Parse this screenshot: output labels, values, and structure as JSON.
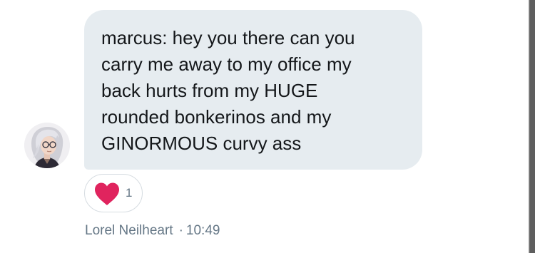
{
  "message": {
    "lines": [
      "marcus: hey you there can you",
      "carry me away to my office my",
      "back hurts from my HUGE",
      "rounded bonkerinos and my",
      "GINORMOUS curvy ass"
    ]
  },
  "reaction": {
    "icon": "heart-icon",
    "color": "#e0245e",
    "count": "1"
  },
  "meta": {
    "sender": "Lorel Neilheart",
    "separator": "·",
    "time": "10:49"
  },
  "colors": {
    "bubble": "#e6ecf0",
    "text": "#14171a",
    "secondary_text": "#657786"
  }
}
